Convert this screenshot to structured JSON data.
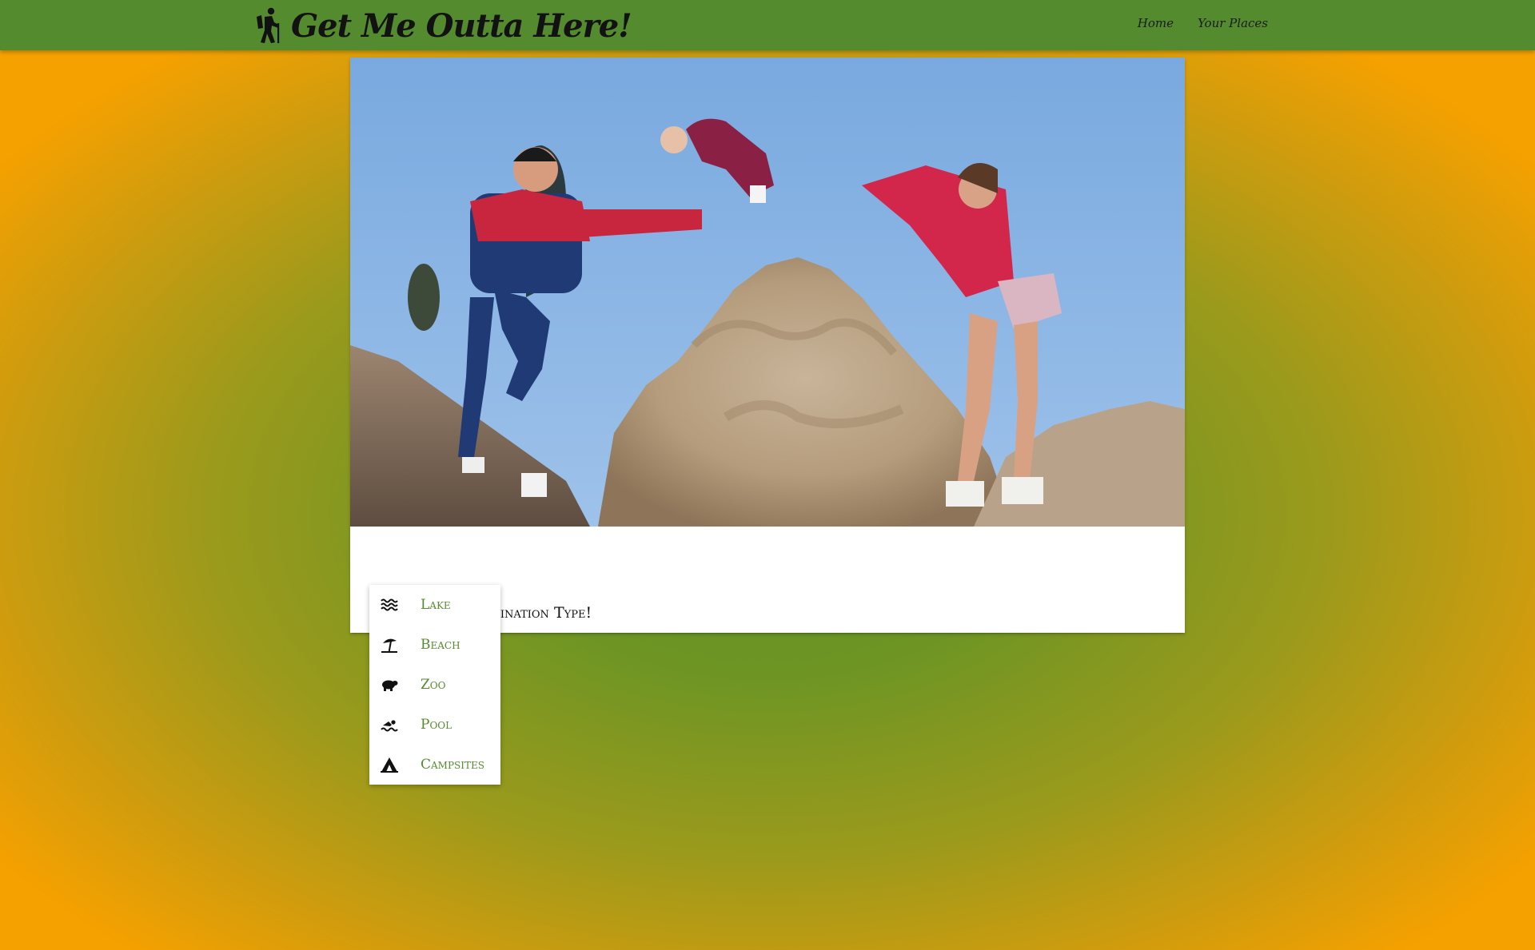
{
  "app": {
    "title": "Get Me Outta Here!",
    "brand_icon": "hiking-person-icon",
    "colors": {
      "navbar": "#558b2f",
      "accent_text": "#558b2f",
      "background_center": "#5f9128",
      "background_edge": "#f5a100"
    }
  },
  "nav": {
    "links": [
      {
        "label": "Home"
      },
      {
        "label": "Your Places"
      }
    ]
  },
  "card": {
    "image": "family-tossing-baby-on-rocks-photo",
    "title": "Choose Your Destination Type!"
  },
  "dropdown": {
    "items": [
      {
        "label": "Lake",
        "icon": "waves-icon"
      },
      {
        "label": "Beach",
        "icon": "beach-umbrella-icon"
      },
      {
        "label": "Zoo",
        "icon": "hippo-icon"
      },
      {
        "label": "Pool",
        "icon": "swimmer-icon"
      },
      {
        "label": "Campsites",
        "icon": "tent-icon"
      }
    ]
  }
}
